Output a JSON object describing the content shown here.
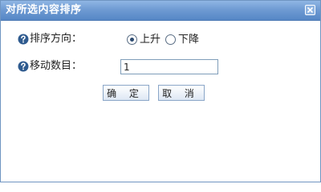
{
  "dialog": {
    "title": "对所选内容排序",
    "close_icon": "close-icon"
  },
  "form": {
    "direction": {
      "label": "排序方向：",
      "options": [
        {
          "label": "上升",
          "checked": true
        },
        {
          "label": "下降",
          "checked": false
        }
      ]
    },
    "move_count": {
      "label": "移动数目：",
      "value": "1"
    }
  },
  "buttons": {
    "confirm": "确 定",
    "cancel": "取 消"
  },
  "colors": {
    "titlebar": "#6f9bd3",
    "help_icon": "#2f5b8f",
    "button_border": "#8aa6c8"
  }
}
